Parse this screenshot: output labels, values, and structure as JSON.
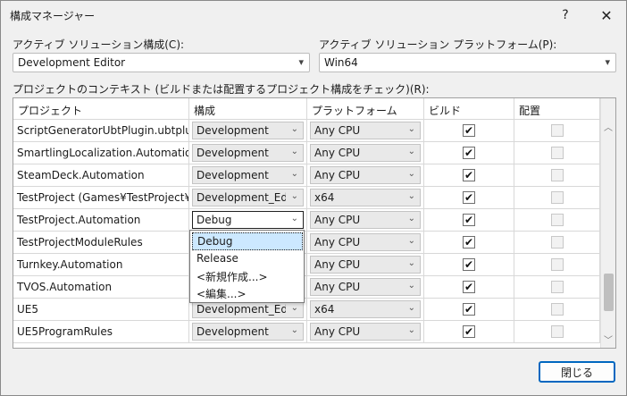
{
  "window": {
    "title": "構成マネージャー",
    "help_label": "?",
    "close_label": "✕"
  },
  "active_config": {
    "label": "アクティブ ソリューション構成(C):",
    "value": "Development Editor"
  },
  "active_platform": {
    "label": "アクティブ ソリューション プラットフォーム(P):",
    "value": "Win64"
  },
  "context_label": "プロジェクトのコンテキスト (ビルドまたは配置するプロジェクト構成をチェック)(R):",
  "columns": [
    "プロジェクト",
    "構成",
    "プラットフォーム",
    "ビルド",
    "配置"
  ],
  "rows": [
    {
      "project": "ScriptGeneratorUbtPlugin.ubtplugin",
      "config": "Development",
      "platform": "Any CPU",
      "build": true,
      "deploy": false
    },
    {
      "project": "SmartlingLocalization.Automation",
      "config": "Development",
      "platform": "Any CPU",
      "build": true,
      "deploy": false
    },
    {
      "project": "SteamDeck.Automation",
      "config": "Development",
      "platform": "Any CPU",
      "build": true,
      "deploy": false
    },
    {
      "project": "TestProject (Games¥TestProject¥Te…",
      "config": "Development_Editc",
      "platform": "x64",
      "build": true,
      "deploy": false
    },
    {
      "project": "TestProject.Automation",
      "config": "Debug",
      "platform": "Any CPU",
      "build": true,
      "deploy": false
    },
    {
      "project": "TestProjectModuleRules",
      "config": "",
      "platform": "Any CPU",
      "build": true,
      "deploy": false
    },
    {
      "project": "Turnkey.Automation",
      "config": "",
      "platform": "Any CPU",
      "build": true,
      "deploy": false
    },
    {
      "project": "TVOS.Automation",
      "config": "",
      "platform": "Any CPU",
      "build": true,
      "deploy": false
    },
    {
      "project": "UE5",
      "config": "Development_Editc",
      "platform": "x64",
      "build": true,
      "deploy": false
    },
    {
      "project": "UE5ProgramRules",
      "config": "Development",
      "platform": "Any CPU",
      "build": true,
      "deploy": false
    }
  ],
  "popup_options": [
    "Debug",
    "Release",
    "<新規作成...>",
    "<編集...>"
  ],
  "popup_selected": "Debug",
  "close_button": "閉じる",
  "icons": {
    "dropdown": "chevron-down-icon",
    "check": "checkmark-icon"
  },
  "colors": {
    "accent": "#0067c0",
    "selection": "#cce8ff"
  }
}
